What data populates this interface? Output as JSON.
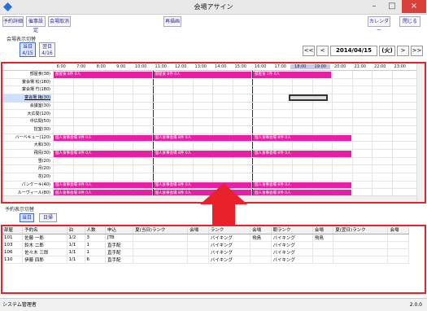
{
  "window": {
    "title": "会場アサイン",
    "minimize": "–",
    "maximize": "□",
    "close": "×"
  },
  "toolbar": {
    "buttons_left": [
      "予約詳細",
      "催事設定",
      "会場取消"
    ],
    "redraw": "再描画",
    "calendar": "カレンダー",
    "close": "閉じる"
  },
  "display_switch": {
    "label": "会場表示切替",
    "today_line1": "当日",
    "today_line2": "4/15",
    "next_line1": "翌日",
    "next_line2": "4/16"
  },
  "date_nav": {
    "first": "<<",
    "prev": "<",
    "date": "2014/04/15",
    "weekday": "(火)",
    "next": ">",
    "last": ">>"
  },
  "timeline": {
    "hours": [
      "6:00",
      "7:00",
      "8:00",
      "9:00",
      "10:00",
      "11:00",
      "12:00",
      "13:00",
      "14:00",
      "15:00",
      "16:00",
      "17:00",
      "18:00",
      "19:00",
      "20:00",
      "21:00",
      "22:00",
      "23:00"
    ],
    "highlighted": [
      "18:00",
      "19:00"
    ]
  },
  "rooms": [
    "部屋食(38)",
    "宴会場 松(180)",
    "宴会場 竹(180)",
    "宴会場 梅(30)",
    "会議室(30)",
    "大広間(120)",
    "中広間(50)",
    "控室(30)",
    "バーベキュー(120)",
    "大和(30)",
    "飛鳥(30)",
    "雪(20)",
    "月(20)",
    "花(20)",
    "パンケーキ(40)",
    "ルーヴィール(80)",
    "ダラウン(100)"
  ],
  "selected_room": "宴会場 梅(30)",
  "bookings": [
    {
      "label": "部屋食 8件 0人"
    },
    {
      "label": "部屋食 8件 0人"
    },
    {
      "label": "部屋食 1件 0人"
    },
    {
      "label": "個人食事会場 8件 0人"
    },
    {
      "label": "個人食事会場 8件 0人"
    },
    {
      "label": "個人食事会場 8件 0人"
    },
    {
      "label": "個人食事会場 8件 0人"
    },
    {
      "label": "個人食事会場 8件 0人"
    },
    {
      "label": "個人食事会場 8件 0人"
    },
    {
      "label": "個人食事会場 8件 0人"
    },
    {
      "label": "個人食事会場 8件 0人"
    },
    {
      "label": "個人食事会場 8件 0人"
    }
  ],
  "reservation_switch": {
    "label": "予約表示切替",
    "tab_today": "当日",
    "tab_daily": "日帰"
  },
  "reservations": {
    "headers": [
      "部屋",
      "予約名",
      "泊",
      "人数",
      "申込",
      "夏(当日)ランク",
      "会場",
      "ランク",
      "会場",
      "朝ランク",
      "会場",
      "夏(翌日)ランク",
      "会場"
    ],
    "rows": [
      [
        "101",
        "佐藤 一郎",
        "1/2",
        "3",
        "JTB",
        "",
        "",
        "バイキング",
        "飛鳥",
        "バイキング",
        "飛鳥",
        "",
        ""
      ],
      [
        "103",
        "鈴木 二郎",
        "1/1",
        "1",
        "直手配",
        "",
        "",
        "バイキング",
        "",
        "バイキング",
        "",
        "",
        ""
      ],
      [
        "106",
        "佐々木 三郎",
        "1/1",
        "1",
        "直手配",
        "",
        "",
        "バイキング",
        "",
        "バイキング",
        "",
        "",
        ""
      ],
      [
        "110",
        "伊藤 四郎",
        "1/1",
        "6",
        "直手配",
        "",
        "",
        "バイキング",
        "",
        "バイキング",
        "",
        "",
        ""
      ]
    ]
  },
  "status": {
    "user": "システム管理者",
    "version": "2.0.0"
  },
  "colors": {
    "booking": "#e81ea5",
    "frame": "#e8212b",
    "arrow": "#e8212b"
  }
}
